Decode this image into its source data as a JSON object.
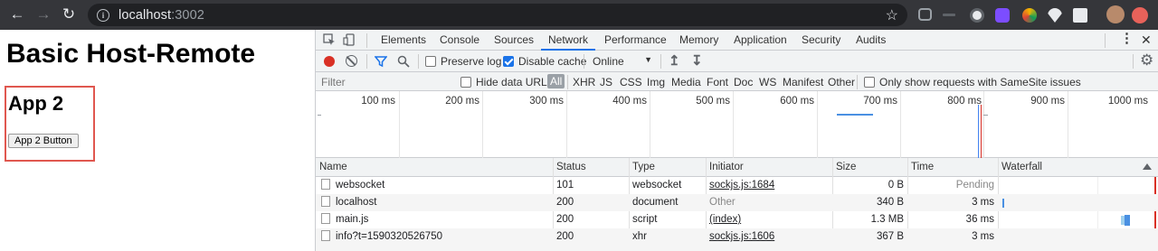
{
  "browser": {
    "url_host": "localhost",
    "url_port": ":3002"
  },
  "page": {
    "title": "Basic Host-Remote",
    "app2_title": "App 2",
    "app2_button": "App 2 Button"
  },
  "devtools": {
    "tabs": [
      "Elements",
      "Console",
      "Sources",
      "Network",
      "Performance",
      "Memory",
      "Application",
      "Security",
      "Audits"
    ],
    "active_tab": "Network",
    "toolbar": {
      "preserve_log": "Preserve log",
      "disable_cache": "Disable cache",
      "throttling": "Online"
    },
    "filter": {
      "placeholder": "Filter",
      "hide_data_urls": "Hide data URLs",
      "types": [
        "All",
        "XHR",
        "JS",
        "CSS",
        "Img",
        "Media",
        "Font",
        "Doc",
        "WS",
        "Manifest",
        "Other"
      ],
      "samesite": "Only show requests with SameSite issues"
    },
    "timeline_ticks": [
      "100 ms",
      "200 ms",
      "300 ms",
      "400 ms",
      "500 ms",
      "600 ms",
      "700 ms",
      "800 ms",
      "900 ms",
      "1000 ms"
    ],
    "columns": [
      "Name",
      "Status",
      "Type",
      "Initiator",
      "Size",
      "Time",
      "Waterfall"
    ],
    "rows": [
      {
        "name": "websocket",
        "status": "101",
        "type": "websocket",
        "initiator": "sockjs.js:1684",
        "size": "0 B",
        "time": "Pending"
      },
      {
        "name": "localhost",
        "status": "200",
        "type": "document",
        "initiator": "Other",
        "size": "340 B",
        "time": "3 ms"
      },
      {
        "name": "main.js",
        "status": "200",
        "type": "script",
        "initiator": "(index)",
        "size": "1.3 MB",
        "time": "36 ms"
      },
      {
        "name": "info?t=1590320526750",
        "status": "200",
        "type": "xhr",
        "initiator": "sockjs.js:1606",
        "size": "367 B",
        "time": "3 ms"
      }
    ]
  },
  "colors": {
    "accent": "#1a73e8",
    "record": "#d93025",
    "highlight_border": "#e0574f"
  }
}
